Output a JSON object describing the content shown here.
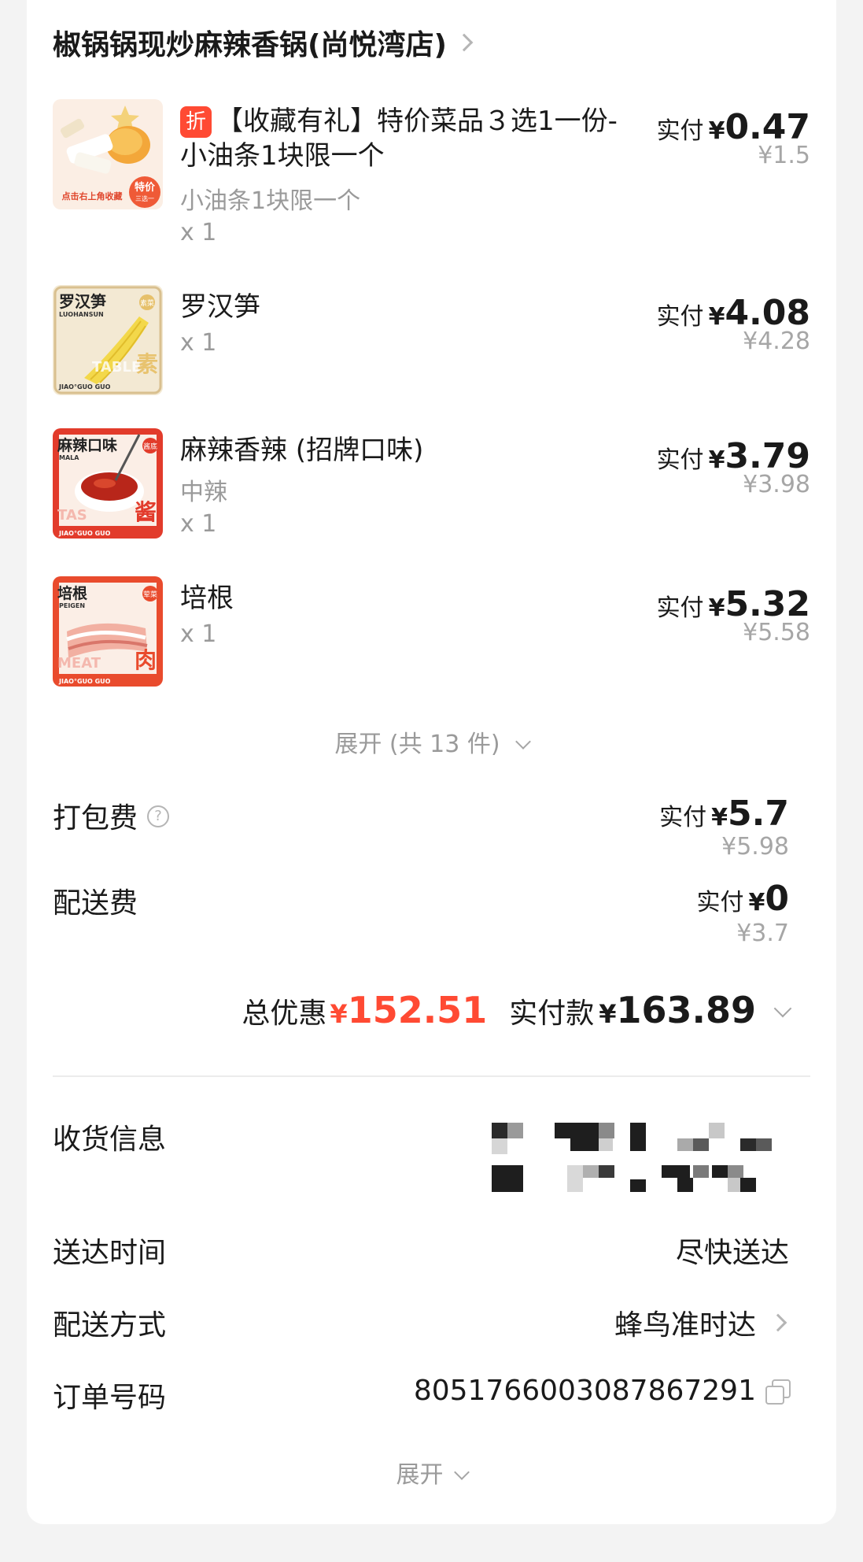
{
  "store": {
    "name": "椒锅锅现炒麻辣香锅(尚悦湾店)"
  },
  "items": [
    {
      "title": "【收藏有礼】特价菜品３选1一份-小油条1块限一个",
      "discount_tag": "折",
      "spec": "小油条1块限一个",
      "qty": "x 1",
      "pay_label": "实付",
      "currency": "¥",
      "pay_value": "0.47",
      "original_price": "¥1.5",
      "thumb": {
        "caption": "点击右上角收藏",
        "badge": "特价",
        "badge_sub": "三选一"
      }
    },
    {
      "title": "罗汉笋",
      "qty": "x 1",
      "pay_label": "实付",
      "currency": "¥",
      "pay_value": "4.08",
      "original_price": "¥4.28",
      "thumb": {
        "name": "罗汉笋",
        "pinyin": "LUOHANSUN",
        "watermark": "TABLE",
        "category": "素",
        "tag": "素菜",
        "brand": "JIAO°GUO GUO"
      }
    },
    {
      "title": "麻辣香辣 (招牌口味)",
      "spec": "中辣",
      "qty": "x 1",
      "pay_label": "实付",
      "currency": "¥",
      "pay_value": "3.79",
      "original_price": "¥3.98",
      "thumb": {
        "name": "麻辣口味",
        "pinyin": "MALA",
        "watermark": "TAS",
        "category": "酱",
        "tag": "酱底",
        "brand": "JIAO°GUO GUO"
      }
    },
    {
      "title": "培根",
      "qty": "x 1",
      "pay_label": "实付",
      "currency": "¥",
      "pay_value": "5.32",
      "original_price": "¥5.58",
      "thumb": {
        "name": "培根",
        "pinyin": "PEIGEN",
        "watermark": "MEAT",
        "category": "肉",
        "tag": "荤菜",
        "brand": "JIAO°GUO GUO"
      }
    }
  ],
  "expand_items": "展开 (共 13 件)",
  "fees": {
    "packing": {
      "label": "打包费",
      "help": "?",
      "pay_label": "实付",
      "currency": "¥",
      "pay_value": "5.7",
      "original_price": "¥5.98"
    },
    "delivery": {
      "label": "配送费",
      "pay_label": "实付",
      "currency": "¥",
      "pay_value": "0",
      "original_price": "¥3.7"
    }
  },
  "summary": {
    "discount_label": "总优惠",
    "discount_currency": "¥",
    "discount_value": "152.51",
    "paid_label": "实付款",
    "paid_currency": "¥",
    "paid_value": "163.89"
  },
  "info": {
    "address_label": "收货信息",
    "time_label": "送达时间",
    "time_value": "尽快送达",
    "method_label": "配送方式",
    "method_value": "蜂鸟准时达",
    "order_label": "订单号码",
    "order_value": "8051766003087867291",
    "expand": "展开"
  },
  "colors": {
    "accent_red": "#ff4a33",
    "muted": "#9a9a9a",
    "background": "#f3f3f3"
  }
}
